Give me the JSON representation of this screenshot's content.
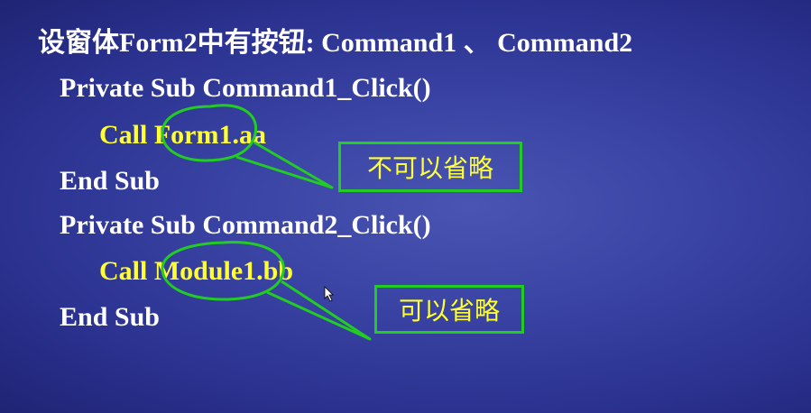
{
  "heading": "设窗体Form2中有按钮: Command1 、 Command2",
  "code": {
    "line1": "Private Sub Command1_Click()",
    "line2": "Call Form1.aa",
    "line3": "End Sub",
    "line4": "Private Sub Command2_Click()",
    "line5": "Call Module1.bb",
    "line6": "End Sub"
  },
  "callouts": {
    "first": "不可以省略",
    "second": "可以省略"
  },
  "colors": {
    "code_text": "#ffffff",
    "call_text": "#ffff33",
    "callout_border": "#22cc22",
    "callout_text": "#ffff33"
  }
}
